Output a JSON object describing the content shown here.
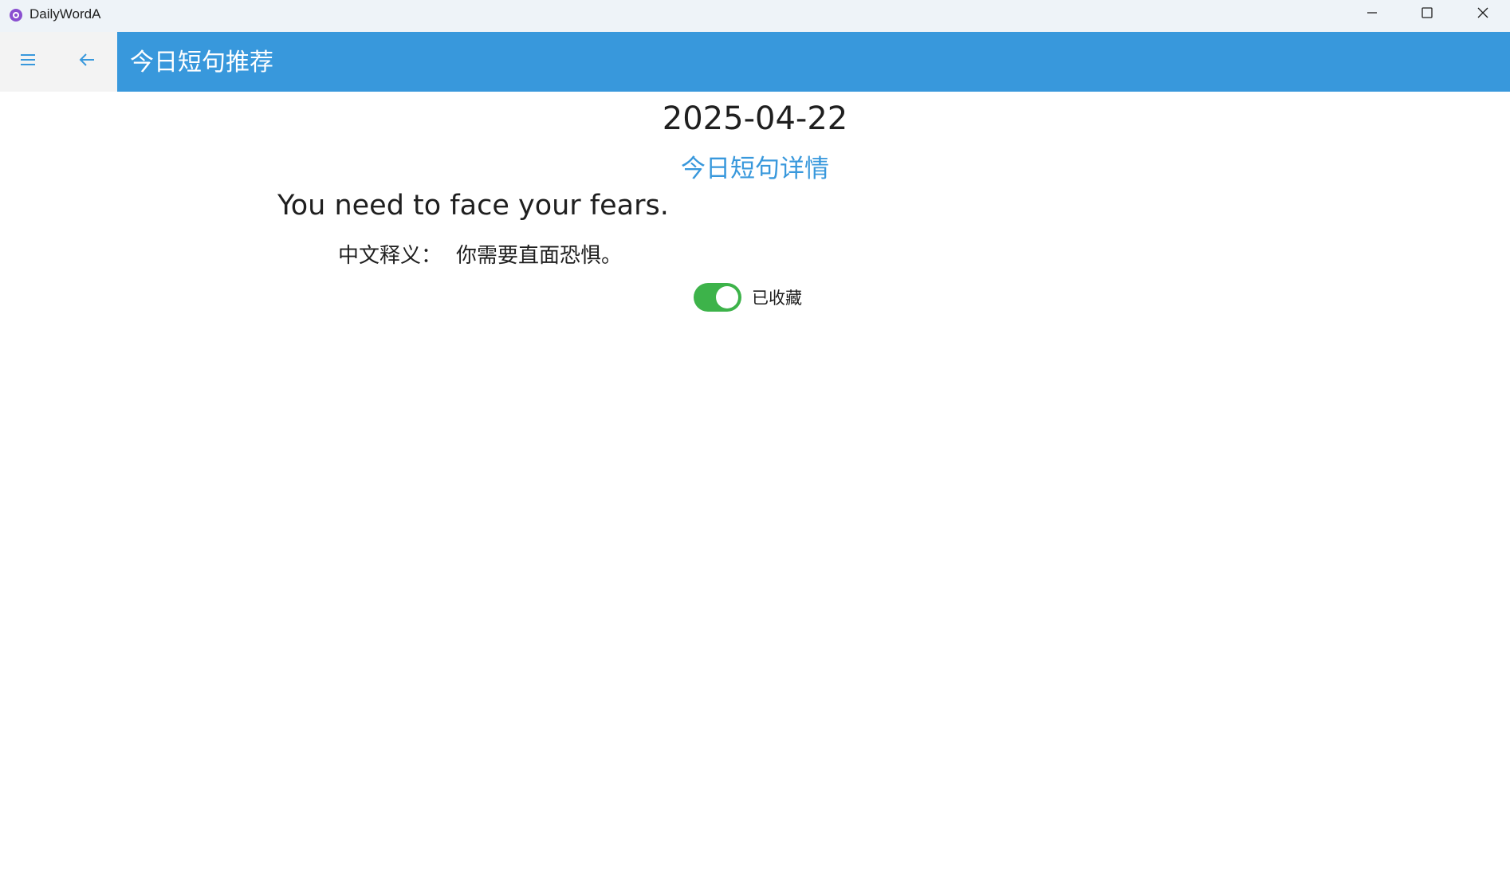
{
  "window": {
    "app_title": "DailyWordA",
    "icon": "app-logo-icon",
    "controls": [
      "minimize-icon",
      "maximize-icon",
      "close-icon"
    ]
  },
  "appbar": {
    "menu_icon": "hamburger-icon",
    "back_icon": "arrow-left-icon",
    "title": "今日短句推荐",
    "accent_color": "#3898dc"
  },
  "content": {
    "date": "2025-04-22",
    "detail_link": "今日短句详情",
    "sentence": "You need to face your fears.",
    "translation_label": "中文释义：",
    "translation_value": "你需要直面恐惧。",
    "favorite": {
      "state": "on",
      "label": "已收藏",
      "toggle_color": "#3db34a"
    }
  }
}
